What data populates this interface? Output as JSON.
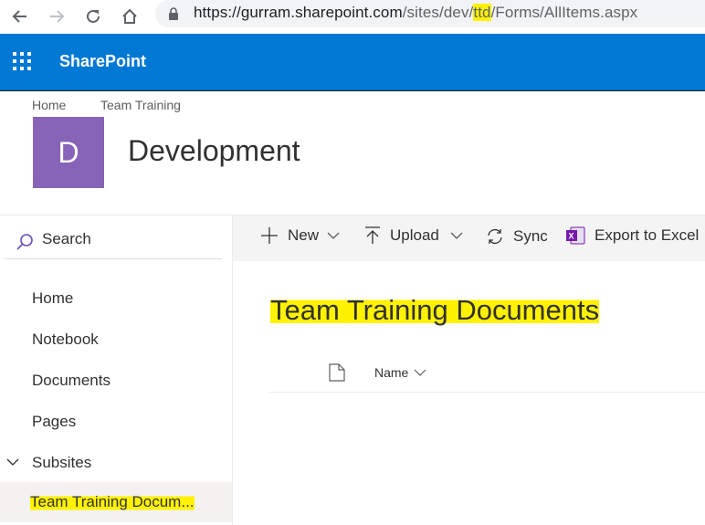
{
  "browser": {
    "url_host": "https://gurram.sharepoint.com",
    "url_path_1": "/sites/dev/",
    "url_highlight": "ttd",
    "url_path_2": "/Forms/AllItems.aspx"
  },
  "suite": {
    "brand": "SharePoint",
    "color": "#0078d4"
  },
  "header": {
    "breadcrumbs": [
      "Home",
      "Team Training"
    ],
    "logo_letter": "D",
    "logo_color": "#8764b8",
    "site_title": "Development"
  },
  "nav": {
    "search_label": "Search",
    "items": [
      "Home",
      "Notebook",
      "Documents",
      "Pages",
      "Subsites"
    ],
    "selected": "Team Training Docum..."
  },
  "commands": {
    "new": "New",
    "upload": "Upload",
    "sync": "Sync",
    "export": "Export to Excel"
  },
  "library": {
    "title": "Team Training Documents",
    "columns": [
      "Name"
    ]
  },
  "highlight_color": "#fff200"
}
